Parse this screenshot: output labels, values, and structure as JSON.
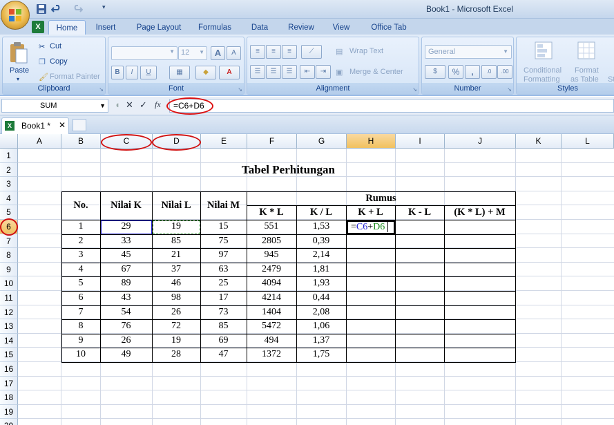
{
  "window": {
    "title": "Book1 - Microsoft Excel"
  },
  "tabs": [
    "Home",
    "Insert",
    "Page Layout",
    "Formulas",
    "Data",
    "Review",
    "View",
    "Office Tab"
  ],
  "ribbon": {
    "clipboard": {
      "label": "Clipboard",
      "paste": "Paste",
      "cut": "Cut",
      "copy": "Copy",
      "format_painter": "Format Painter"
    },
    "font": {
      "label": "Font",
      "size": "12",
      "bold": "B",
      "italic": "I",
      "underline": "U",
      "grow": "A",
      "shrink": "A"
    },
    "alignment": {
      "label": "Alignment",
      "wrap": "Wrap Text",
      "merge": "Merge & Center"
    },
    "number": {
      "label": "Number",
      "format": "General",
      "percent": "%",
      "comma": ","
    },
    "styles": {
      "label": "Styles",
      "cond1": "Conditional",
      "cond2": "Formatting",
      "fmt1": "Format",
      "fmt2": "as Table",
      "cell": "St"
    }
  },
  "formula_bar": {
    "name_box": "SUM",
    "fx": "fx",
    "formula": "=C6+D6"
  },
  "book_tab": {
    "name": "Book1 *",
    "close": "✕"
  },
  "columns": [
    "A",
    "B",
    "C",
    "D",
    "E",
    "F",
    "G",
    "H",
    "I",
    "J",
    "K",
    "L"
  ],
  "rows": [
    "1",
    "2",
    "3",
    "4",
    "5",
    "6",
    "7",
    "8",
    "9",
    "10",
    "11",
    "12",
    "13",
    "14",
    "15",
    "16",
    "17",
    "18",
    "19",
    "20"
  ],
  "sheet": {
    "title": "Tabel Perhitungan",
    "headers": {
      "no": "No.",
      "k": "Nilai K",
      "l": "Nilai L",
      "m": "Nilai M",
      "rumus": "Rumus",
      "kxl": "K * L",
      "kdl": "K / L",
      "kpl": "K + L",
      "kml": "K - L",
      "exp": "(K * L) + M"
    },
    "editing_cell": {
      "eq": "=",
      "c6": "C6",
      "plus": "+",
      "d6": "D6"
    },
    "data": [
      [
        "1",
        "29",
        "19",
        "15",
        "551",
        "1,53"
      ],
      [
        "2",
        "33",
        "85",
        "75",
        "2805",
        "0,39"
      ],
      [
        "3",
        "45",
        "21",
        "97",
        "945",
        "2,14"
      ],
      [
        "4",
        "67",
        "37",
        "63",
        "2479",
        "1,81"
      ],
      [
        "5",
        "89",
        "46",
        "25",
        "4094",
        "1,93"
      ],
      [
        "6",
        "43",
        "98",
        "17",
        "4214",
        "0,44"
      ],
      [
        "7",
        "54",
        "26",
        "73",
        "1404",
        "2,08"
      ],
      [
        "8",
        "76",
        "72",
        "85",
        "5472",
        "1,06"
      ],
      [
        "9",
        "26",
        "19",
        "69",
        "494",
        "1,37"
      ],
      [
        "10",
        "49",
        "28",
        "47",
        "1372",
        "1,75"
      ]
    ]
  },
  "colors": {
    "annotation": "#d11111",
    "ref_c6": "#1f1fd1",
    "ref_d6": "#1a8a1a"
  }
}
